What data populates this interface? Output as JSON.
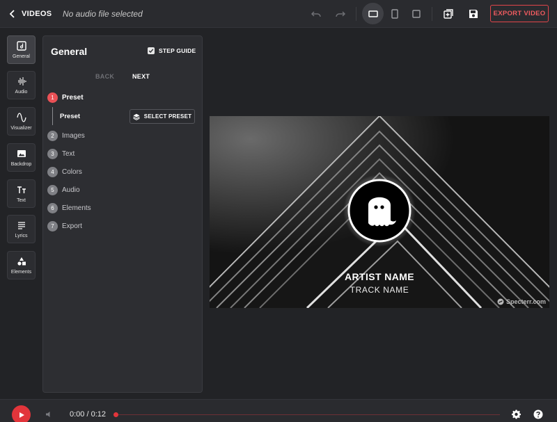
{
  "topbar": {
    "back_label": "VIDEOS",
    "audio_file": "No audio file selected",
    "export_label": "EXPORT VIDEO",
    "icons": [
      "undo-icon",
      "redo-icon",
      "landscape-icon",
      "portrait-icon",
      "square-icon",
      "add-layer-icon",
      "save-icon"
    ],
    "active_aspect": "landscape"
  },
  "rail": {
    "items": [
      {
        "label": "General",
        "icon": "general-icon",
        "active": true
      },
      {
        "label": "Audio",
        "icon": "waveform-icon",
        "active": false
      },
      {
        "label": "Visualizer",
        "icon": "sine-wave-icon",
        "active": false
      },
      {
        "label": "Backdrop",
        "icon": "image-icon",
        "active": false
      },
      {
        "label": "Text",
        "icon": "text-icon",
        "active": false
      },
      {
        "label": "Lyrics",
        "icon": "lyrics-icon",
        "active": false
      },
      {
        "label": "Elements",
        "icon": "shapes-icon",
        "active": false
      }
    ]
  },
  "panel": {
    "title": "General",
    "step_guide_label": "STEP GUIDE",
    "step_guide_checked": true,
    "back_label": "BACK",
    "next_label": "NEXT",
    "steps": [
      {
        "num": "1",
        "label": "Preset",
        "active": true
      },
      {
        "num": "2",
        "label": "Images",
        "active": false
      },
      {
        "num": "3",
        "label": "Text",
        "active": false
      },
      {
        "num": "4",
        "label": "Colors",
        "active": false
      },
      {
        "num": "5",
        "label": "Audio",
        "active": false
      },
      {
        "num": "6",
        "label": "Elements",
        "active": false
      },
      {
        "num": "7",
        "label": "Export",
        "active": false
      }
    ],
    "substep_label": "Preset",
    "select_preset_label": "SELECT PRESET"
  },
  "preview": {
    "artist_name": "ARTIST NAME",
    "track_name": "TRACK NAME",
    "watermark": "Specterr.com"
  },
  "player": {
    "time": "0:00 / 0:12",
    "progress": 0,
    "colors": {
      "accent": "#e2353b",
      "track": "#6c3035"
    }
  }
}
